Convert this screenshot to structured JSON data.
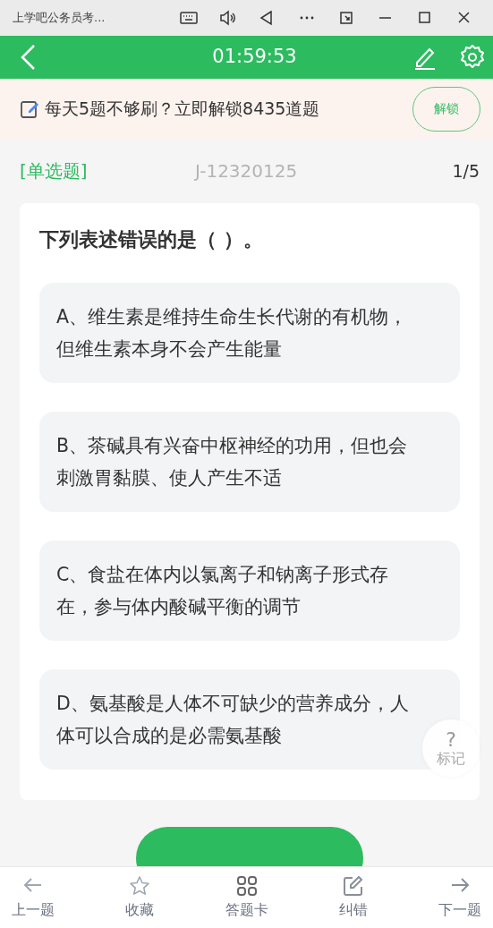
{
  "window": {
    "title": "上学吧公务员考..."
  },
  "header": {
    "timer": "01:59:53"
  },
  "banner": {
    "text": "每天5题不够刷？立即解锁8435道题",
    "button": "解锁"
  },
  "question": {
    "type_label": "[单选题]",
    "code": "J-12320125",
    "progress": "1/5",
    "stem": "下列表述错误的是（ ）。",
    "options": [
      {
        "text": "A、维生素是维持生命生长代谢的有机物，但维生素本身不会产生能量",
        "selected": false
      },
      {
        "text": "B、茶碱具有兴奋中枢神经的功用，但也会刺激胃黏膜、使人产生不适",
        "selected": false
      },
      {
        "text": "C、食盐在体内以氯离子和钠离子形式存在，参与体内酸碱平衡的调节",
        "selected": false
      },
      {
        "text": "D、氨基酸是人体不可缺少的营养成分，人体可以合成的是必需氨基酸",
        "selected": false
      }
    ]
  },
  "mark_button": {
    "symbol": "?",
    "label": "标记"
  },
  "bottom_nav": [
    {
      "label": "上一题",
      "kind": "prev"
    },
    {
      "label": "收藏",
      "kind": "star"
    },
    {
      "label": "答题卡",
      "kind": "grid"
    },
    {
      "label": "纠错",
      "kind": "edit"
    },
    {
      "label": "下一题",
      "kind": "next"
    }
  ]
}
